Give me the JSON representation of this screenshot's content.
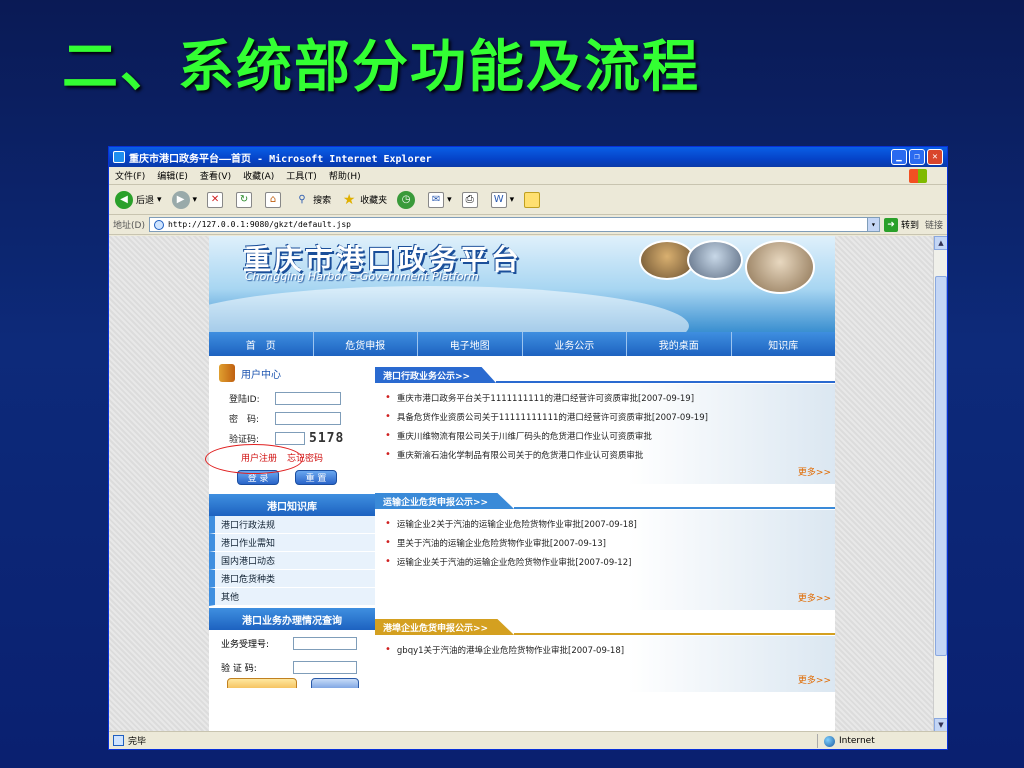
{
  "slide": {
    "title": "二、系统部分功能及流程"
  },
  "window": {
    "title": "重庆市港口政务平台——首页 - Microsoft Internet Explorer",
    "menu": [
      "文件(F)",
      "编辑(E)",
      "查看(V)",
      "收藏(A)",
      "工具(T)",
      "帮助(H)"
    ],
    "toolbar": {
      "back": "后退",
      "search": "搜索",
      "favorites": "收藏夹"
    },
    "address_label": "地址(D)",
    "address": "http://127.0.0.1:9080/gkzt/default.jsp",
    "go_label": "转到",
    "links_label": "链接",
    "status_text": "完毕",
    "zone": "Internet"
  },
  "site": {
    "title": "重庆市港口政务平台",
    "subtitle": "Chongqing Harbor e-Government Platform",
    "nav": [
      "首　页",
      "危货申报",
      "电子地图",
      "业务公示",
      "我的桌面",
      "知识库"
    ],
    "user_center": {
      "heading": "用户中心",
      "login_id_label": "登陆ID:",
      "password_label": "密　码:",
      "captcha_label": "验证码:",
      "captcha_value": "5178",
      "register_link": "用户注册",
      "forgot_link": "忘记密码",
      "login_button": "登 录",
      "reset_button": "重 置"
    },
    "knowledge": {
      "heading": "港口知识库",
      "items": [
        "港口行政法规",
        "港口作业需知",
        "国内港口动态",
        "港口危货种类",
        "其他"
      ]
    },
    "query": {
      "heading": "港口业务办理情况查询",
      "acceptance_label": "业务受理号:",
      "captcha_label": "验 证 码:"
    },
    "sections": [
      {
        "heading": "港口行政业务公示>>",
        "color": "#2a6ad0",
        "items": [
          "重庆市港口政务平台关于1111111111的港口经营许可资质审批[2007-09-19]",
          "具备危货作业资质公司关于11111111111的港口经营许可资质审批[2007-09-19]",
          "重庆川维物流有限公司关于川维厂码头的危货港口作业认可资质审批",
          "重庆新渝石油化学制品有限公司关于的危货港口作业认可资质审批"
        ],
        "more": "更多>>"
      },
      {
        "heading": "运输企业危货申报公示>>",
        "color": "#3a8ad8",
        "items": [
          "运输企业2关于汽油的运输企业危险货物作业审批[2007-09-18]",
          "里关于汽油的运输企业危险货物作业审批[2007-09-13]",
          "运输企业关于汽油的运输企业危险货物作业审批[2007-09-12]"
        ],
        "more": "更多>>"
      },
      {
        "heading": "港埠企业危货申报公示>>",
        "color": "#d4a020",
        "items": [
          "gbqy1关于汽油的港埠企业危险货物作业审批[2007-09-18]"
        ],
        "more": "更多>>"
      }
    ]
  }
}
